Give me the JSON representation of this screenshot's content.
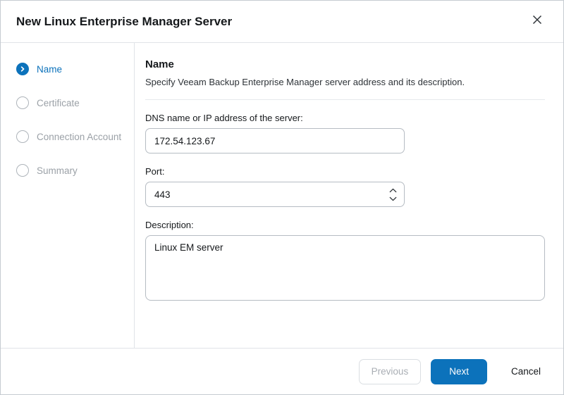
{
  "dialog": {
    "title": "New Linux Enterprise Manager Server"
  },
  "steps": [
    {
      "label": "Name",
      "state": "active"
    },
    {
      "label": "Certificate",
      "state": "pending"
    },
    {
      "label": "Connection Account",
      "state": "pending"
    },
    {
      "label": "Summary",
      "state": "pending"
    }
  ],
  "content": {
    "heading": "Name",
    "subtitle": "Specify Veeam Backup Enterprise Manager server address and its description.",
    "fields": {
      "dns": {
        "label": "DNS name or IP address of the server:",
        "value": "172.54.123.67"
      },
      "port": {
        "label": "Port:",
        "value": "443"
      },
      "description": {
        "label": "Description:",
        "value": "Linux EM server"
      }
    }
  },
  "footer": {
    "previous_label": "Previous",
    "next_label": "Next",
    "cancel_label": "Cancel"
  },
  "colors": {
    "accent": "#0c72bb"
  }
}
